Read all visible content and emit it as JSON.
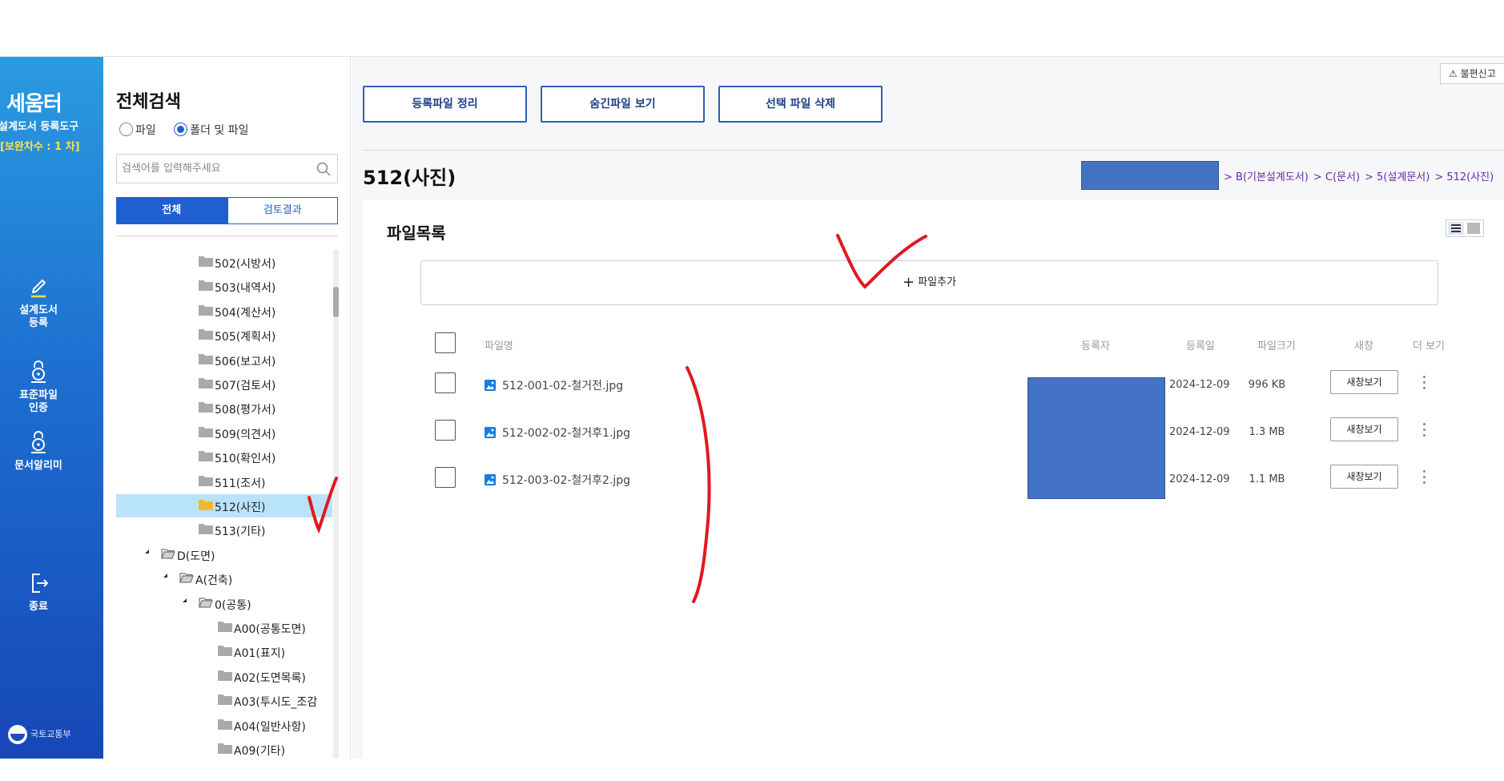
{
  "sidebar": {
    "brand_title": "세움터",
    "brand_subtitle": "설계도서 등록도구",
    "revision": "[보완차수 : 1 차]",
    "nav": [
      {
        "label_lines": [
          "설계도서",
          "등록"
        ],
        "icon": "pencil-icon"
      },
      {
        "label_lines": [
          "표준파일",
          "인증"
        ],
        "icon": "lock-icon"
      },
      {
        "label_lines": [
          "문서알리미"
        ],
        "icon": "lock-icon"
      },
      {
        "label_lines": [
          "종료"
        ],
        "icon": "exit-icon"
      }
    ],
    "ministry": "국토교통부"
  },
  "search_panel": {
    "title": "전체검색",
    "radio_options": [
      {
        "label": "파일",
        "checked": false
      },
      {
        "label": "폴더 및 파일",
        "checked": true
      }
    ],
    "search_placeholder": "검색어를 입력해주세요",
    "tabs": [
      {
        "label": "전체",
        "active": true
      },
      {
        "label": "검토결과",
        "active": false
      }
    ]
  },
  "tree": [
    {
      "label": "502(시방서)",
      "depth": 3,
      "open": false,
      "selected": false
    },
    {
      "label": "503(내역서)",
      "depth": 3,
      "open": false,
      "selected": false
    },
    {
      "label": "504(계산서)",
      "depth": 3,
      "open": false,
      "selected": false
    },
    {
      "label": "505(계획서)",
      "depth": 3,
      "open": false,
      "selected": false
    },
    {
      "label": "506(보고서)",
      "depth": 3,
      "open": false,
      "selected": false
    },
    {
      "label": "507(검토서)",
      "depth": 3,
      "open": false,
      "selected": false
    },
    {
      "label": "508(평가서)",
      "depth": 3,
      "open": false,
      "selected": false
    },
    {
      "label": "509(의견서)",
      "depth": 3,
      "open": false,
      "selected": false
    },
    {
      "label": "510(확인서)",
      "depth": 3,
      "open": false,
      "selected": false
    },
    {
      "label": "511(조서)",
      "depth": 3,
      "open": false,
      "selected": false
    },
    {
      "label": "512(사진)",
      "depth": 3,
      "open": false,
      "selected": true
    },
    {
      "label": "513(기타)",
      "depth": 3,
      "open": false,
      "selected": false
    },
    {
      "label": "D(도면)",
      "depth": 1,
      "open": true,
      "selected": false
    },
    {
      "label": "A(건축)",
      "depth": 2,
      "open": true,
      "selected": false
    },
    {
      "label": "0(공통)",
      "depth": 3,
      "open": true,
      "selected": false
    },
    {
      "label": "A00(공통도면)",
      "depth": 4,
      "open": false,
      "selected": false
    },
    {
      "label": "A01(표지)",
      "depth": 4,
      "open": false,
      "selected": false
    },
    {
      "label": "A02(도면목록)",
      "depth": 4,
      "open": false,
      "selected": false
    },
    {
      "label": "A03(투시도_조감",
      "depth": 4,
      "open": false,
      "selected": false
    },
    {
      "label": "A04(일반사항)",
      "depth": 4,
      "open": false,
      "selected": false
    },
    {
      "label": "A09(기타)",
      "depth": 4,
      "open": false,
      "selected": false
    }
  ],
  "toolbar": {
    "report_label": "불편신고",
    "actions": [
      "등록파일 정리",
      "숨긴파일 보기",
      "선택 파일 삭제"
    ]
  },
  "page": {
    "title": "512(사진)",
    "breadcrumb": [
      "> B(기본설계도서)",
      "> C(문서)",
      "> 5(설계문서)",
      "> 512(사진)"
    ]
  },
  "file_list": {
    "title": "파일목록",
    "add_label": "파일추가",
    "columns": [
      "파일명",
      "등록자",
      "등록일",
      "파일크기",
      "새창",
      "더 보기"
    ],
    "new_window_label": "새창보기",
    "rows": [
      {
        "name": "512-001-02-철거전.jpg",
        "date": "2024-12-09",
        "size": "996 KB"
      },
      {
        "name": "512-002-02-철거후1.jpg",
        "date": "2024-12-09",
        "size": "1.3 MB"
      },
      {
        "name": "512-003-02-철거후2.jpg",
        "date": "2024-12-09",
        "size": "1.1 MB"
      }
    ]
  },
  "colors": {
    "sidebar_top": "#2a9be0",
    "sidebar_bottom": "#1747b8",
    "accent": "#1f5fd0",
    "redaction": "#4472c4",
    "annotation": "#e0191f"
  }
}
